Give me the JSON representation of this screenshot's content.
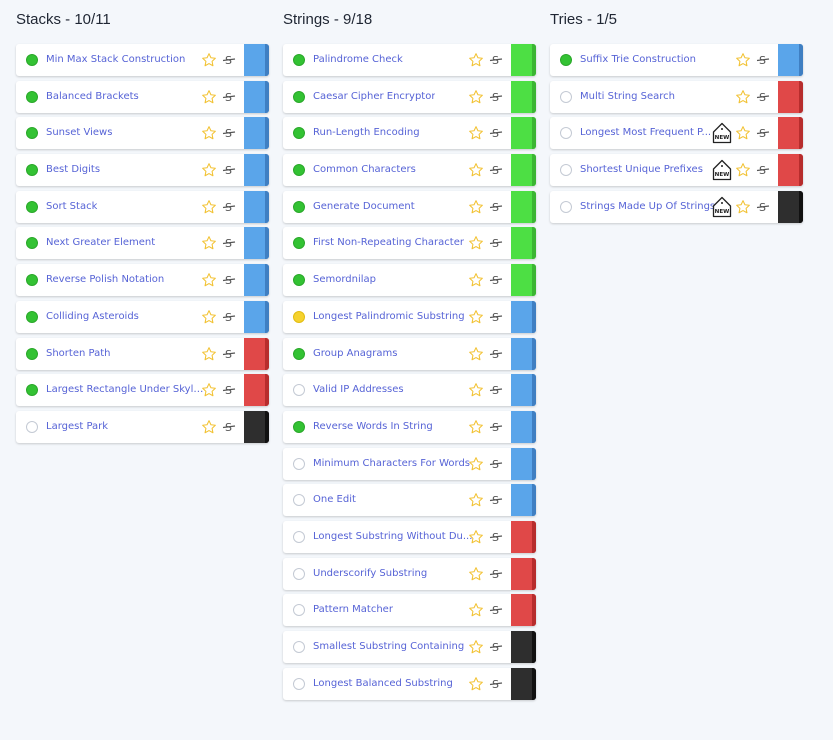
{
  "colors": {
    "easy": "#4ddf44",
    "easy_edge": "#3bb533",
    "medium": "#5aa5ea",
    "medium_edge": "#3f7fc2",
    "hard": "#e04848",
    "hard_edge": "#b72d2d",
    "very_hard": "#2e2e2e",
    "very_hard_edge": "#111111",
    "star": "#f2c233"
  },
  "columns": [
    {
      "title": "Stacks - 10/11",
      "items": [
        {
          "name": "Min Max Stack Construction",
          "status": "complete",
          "difficulty": "medium"
        },
        {
          "name": "Balanced Brackets",
          "status": "complete",
          "difficulty": "medium"
        },
        {
          "name": "Sunset Views",
          "status": "complete",
          "difficulty": "medium"
        },
        {
          "name": "Best Digits",
          "status": "complete",
          "difficulty": "medium"
        },
        {
          "name": "Sort Stack",
          "status": "complete",
          "difficulty": "medium"
        },
        {
          "name": "Next Greater Element",
          "status": "complete",
          "difficulty": "medium"
        },
        {
          "name": "Reverse Polish Notation",
          "status": "complete",
          "difficulty": "medium"
        },
        {
          "name": "Colliding Asteroids",
          "status": "complete",
          "difficulty": "medium"
        },
        {
          "name": "Shorten Path",
          "status": "complete",
          "difficulty": "hard"
        },
        {
          "name": "Largest Rectangle Under Skyline",
          "status": "complete",
          "difficulty": "hard"
        },
        {
          "name": "Largest Park",
          "status": "not-started",
          "difficulty": "very_hard"
        }
      ]
    },
    {
      "title": "Strings - 9/18",
      "items": [
        {
          "name": "Palindrome Check",
          "status": "complete",
          "difficulty": "easy"
        },
        {
          "name": "Caesar Cipher Encryptor",
          "status": "complete",
          "difficulty": "easy"
        },
        {
          "name": "Run-Length Encoding",
          "status": "complete",
          "difficulty": "easy"
        },
        {
          "name": "Common Characters",
          "status": "complete",
          "difficulty": "easy"
        },
        {
          "name": "Generate Document",
          "status": "complete",
          "difficulty": "easy"
        },
        {
          "name": "First Non-Repeating Character",
          "status": "complete",
          "difficulty": "easy"
        },
        {
          "name": "Semordnilap",
          "status": "complete",
          "difficulty": "easy"
        },
        {
          "name": "Longest Palindromic Substring",
          "status": "in-progress",
          "difficulty": "medium"
        },
        {
          "name": "Group Anagrams",
          "status": "complete",
          "difficulty": "medium"
        },
        {
          "name": "Valid IP Addresses",
          "status": "not-started",
          "difficulty": "medium"
        },
        {
          "name": "Reverse Words In String",
          "status": "complete",
          "difficulty": "medium"
        },
        {
          "name": "Minimum Characters For Words",
          "status": "not-started",
          "difficulty": "medium"
        },
        {
          "name": "One Edit",
          "status": "not-started",
          "difficulty": "medium"
        },
        {
          "name": "Longest Substring Without Du...",
          "status": "not-started",
          "difficulty": "hard"
        },
        {
          "name": "Underscorify Substring",
          "status": "not-started",
          "difficulty": "hard"
        },
        {
          "name": "Pattern Matcher",
          "status": "not-started",
          "difficulty": "hard"
        },
        {
          "name": "Smallest Substring Containing",
          "status": "not-started",
          "difficulty": "very_hard"
        },
        {
          "name": "Longest Balanced Substring",
          "status": "not-started",
          "difficulty": "very_hard"
        }
      ]
    },
    {
      "title": "Tries - 1/5",
      "items": [
        {
          "name": "Suffix Trie Construction",
          "status": "complete",
          "difficulty": "medium"
        },
        {
          "name": "Multi String Search",
          "status": "not-started",
          "difficulty": "hard"
        },
        {
          "name": "Longest Most Frequent P...",
          "status": "not-started",
          "difficulty": "hard",
          "badge": "NEW"
        },
        {
          "name": "Shortest Unique Prefixes",
          "status": "not-started",
          "difficulty": "hard",
          "badge": "NEW"
        },
        {
          "name": "Strings Made Up Of Strings",
          "status": "not-started",
          "difficulty": "very_hard",
          "badge": "NEW"
        }
      ]
    }
  ]
}
